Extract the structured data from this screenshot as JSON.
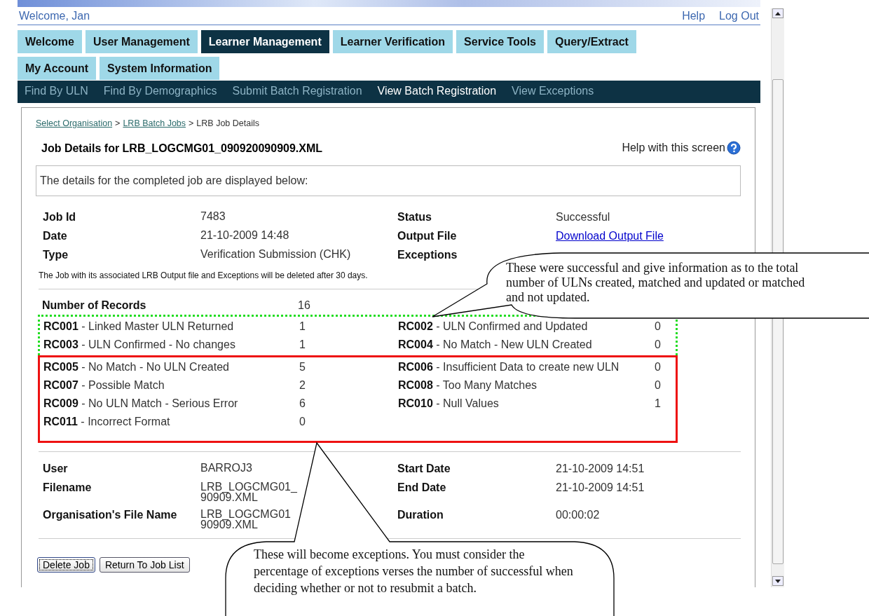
{
  "top_bar": {
    "welcome": "Welcome, Jan",
    "links": [
      "Help",
      "Log Out"
    ]
  },
  "tabs": [
    {
      "label": "Welcome",
      "selected": false
    },
    {
      "label": "User Management",
      "selected": false
    },
    {
      "label": "Learner Management",
      "selected": true
    },
    {
      "label": "Learner Verification",
      "selected": false
    },
    {
      "label": "Service Tools",
      "selected": false
    },
    {
      "label": "Query/Extract",
      "selected": false
    },
    {
      "label": "My Account",
      "selected": false
    },
    {
      "label": "System Information",
      "selected": false
    }
  ],
  "sub_nav": [
    {
      "label": "Find By ULN",
      "selected": false
    },
    {
      "label": "Find By Demographics",
      "selected": false
    },
    {
      "label": "Submit Batch Registration",
      "selected": false
    },
    {
      "label": "View Batch Registration",
      "selected": true
    },
    {
      "label": "View Exceptions",
      "selected": false
    }
  ],
  "breadcrumb": {
    "links": [
      "Select Organisation",
      "LRB Batch Jobs"
    ],
    "separator": ">",
    "current": "LRB Job Details"
  },
  "title": "Job Details for LRB_LOGCMG01_090920090909.XML",
  "help_link": "Help with this screen",
  "info_message": "The details for the completed job are displayed below:",
  "details": [
    {
      "label": "Job Id",
      "value": [
        "7483"
      ],
      "label_2": "Status",
      "value_2": "Successful",
      "value_2_link": false
    },
    {
      "label": "Date",
      "value": [
        "21-10-2009 14:48"
      ],
      "label_2": "Output File",
      "value_2": "Download Output File",
      "value_2_link": true
    },
    {
      "label": "Type",
      "value": [
        "Verification Submission (CHK)"
      ],
      "label_2": "Exceptions"
    }
  ],
  "retention_note": "The Job with its associated LRB Output file and Exceptions will be deleted after 30 days.",
  "records": {
    "label": "Number of Records",
    "value": "16",
    "groups": [
      {
        "kind": "success",
        "items": [
          {
            "code": "RC001",
            "description": " - Linked Master ULN Returned",
            "count": "1"
          },
          {
            "code": "RC002",
            "description": " - ULN Confirmed and Updated",
            "count": "0"
          },
          {
            "code": "RC003",
            "description": " - ULN Confirmed - No changes",
            "count": "1"
          },
          {
            "code": "RC004",
            "description": " - No Match - New ULN Created",
            "count": "0"
          }
        ]
      },
      {
        "kind": "exception",
        "items": [
          {
            "code": "RC005",
            "description": " - No Match - No ULN Created",
            "count": "5"
          },
          {
            "code": "RC006",
            "description": " - Insufficient Data to create new ULN",
            "count": "0"
          },
          {
            "code": "RC007",
            "description": " - Possible Match",
            "count": "2"
          },
          {
            "code": "RC008",
            "description": " - Too Many Matches",
            "count": "0"
          },
          {
            "code": "RC009",
            "description": " - No ULN Match - Serious Error",
            "count": "6"
          },
          {
            "code": "RC010",
            "description": " - Null Values",
            "count": "1"
          },
          {
            "code": "RC011",
            "description": " - Incorrect Format",
            "count": "0"
          }
        ]
      }
    ]
  },
  "job_info": [
    {
      "label": "User",
      "value": [
        "BARROJ3"
      ],
      "label_2": "Start Date",
      "value_2": "21-10-2009 14:51"
    },
    {
      "label": "Filename",
      "value": [
        "LRB_LOGCMG01_",
        "90909.XML"
      ],
      "label_2": "End Date",
      "value_2": "21-10-2009 14:51"
    },
    {
      "label": "Organisation's File Name",
      "value": [
        "LRB_LOGCMG01",
        "90909.XML"
      ],
      "label_2": "Duration",
      "value_2": "00:00:02"
    }
  ],
  "buttons": [
    {
      "label": "Delete Job",
      "focused": true
    },
    {
      "label": "Return To Job List",
      "focused": false
    }
  ],
  "callouts": [
    {
      "kind": "success",
      "text": "These were successful and give information as to the total number of ULNs created, matched and updated or matched and not updated."
    },
    {
      "kind": "exception",
      "text": "These will become exceptions. You must consider the percentage of exceptions verses the number of successful when deciding whether or not to resubmit a batch."
    }
  ]
}
